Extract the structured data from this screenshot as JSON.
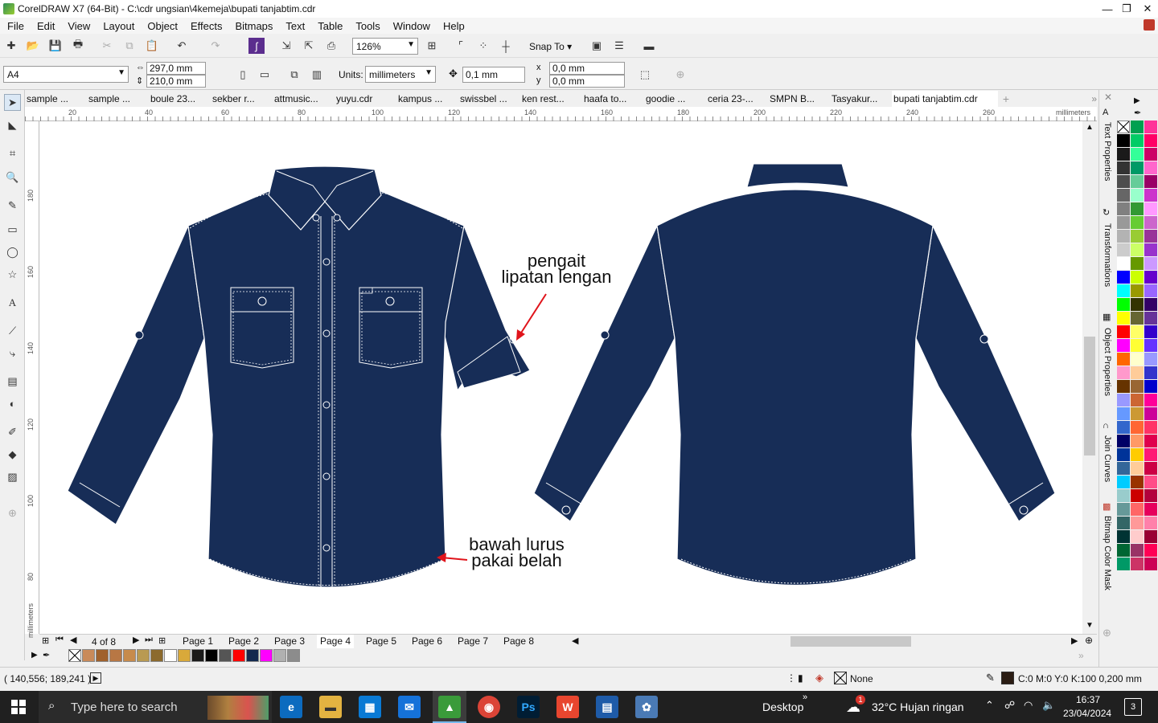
{
  "window": {
    "title": "CorelDRAW X7 (64-Bit) - C:\\cdr ungsian\\4kemeja\\bupati tanjabtim.cdr",
    "minimize": "—",
    "restore": "❐",
    "close": "✕"
  },
  "menu": [
    "File",
    "Edit",
    "View",
    "Layout",
    "Object",
    "Effects",
    "Bitmaps",
    "Text",
    "Table",
    "Tools",
    "Window",
    "Help"
  ],
  "toolbar": {
    "zoom": "126%",
    "snap_to": "Snap To"
  },
  "property_bar": {
    "page_size": "A4",
    "width": "297,0 mm",
    "height": "210,0 mm",
    "units_label": "Units:",
    "units": "millimeters",
    "nudge": "0,1 mm",
    "dup_x": "0,0 mm",
    "dup_y": "0,0 mm"
  },
  "doc_tabs": [
    "sample ...",
    "sample ...",
    "boule 23...",
    "sekber r...",
    "attmusic...",
    "yuyu.cdr",
    "kampus ...",
    "swissbel ...",
    "ken rest...",
    "haafa to...",
    "goodie ...",
    "ceria 23-...",
    "SMPN B...",
    "Tasyakur...",
    "bupati tanjabtim.cdr"
  ],
  "ruler": {
    "h_ticks": [
      "20",
      "40",
      "60",
      "80",
      "100",
      "120",
      "140",
      "160",
      "180",
      "200",
      "220",
      "240",
      "260"
    ],
    "h_unit": "millimeters",
    "v_ticks": [
      "180",
      "160",
      "140",
      "120",
      "100",
      "80"
    ],
    "v_unit": "millimeters"
  },
  "annotations": {
    "a1_line1": "pengait",
    "a1_line2": "lipatan lengan",
    "a2_line1": "bawah lurus",
    "a2_line2": "pakai belah"
  },
  "pages": {
    "counter": "4 of 8",
    "tabs": [
      "Page 1",
      "Page 2",
      "Page 3",
      "Page 4",
      "Page 5",
      "Page 6",
      "Page 7",
      "Page 8"
    ],
    "active": "Page 4"
  },
  "status": {
    "coords": "( 140,556; 189,241 )",
    "fill": "None",
    "outline": "C:0 M:0 Y:0 K:100  0,200 mm"
  },
  "dockers": [
    "Text Properties",
    "Transformations",
    "Object Properties",
    "Join Curves",
    "Bitmap Color Mask"
  ],
  "colors": {
    "shirt": "#172d57",
    "arrow": "#e0141b",
    "accent": "#3a9b3a"
  },
  "bottom_swatches": [
    "#c98a5a",
    "#a0612c",
    "#b87744",
    "#c78b4c",
    "#b99a52",
    "#8c6a2d",
    "#ffffff",
    "#d9a93a",
    "#1a1a1a",
    "#000000",
    "#555555",
    "#ff0000",
    "#13294f",
    "#ff00ff",
    "#b0b0b0",
    "#8c8c8c"
  ],
  "palette_col1": [
    "#ffffff",
    "#000000",
    "#1a1a1a",
    "#333333",
    "#4d4d4d",
    "#666666",
    "#808080",
    "#999999",
    "#b3b3b3",
    "#cccccc",
    "#ffffff",
    "#0000ff",
    "#00ffff",
    "#00ff00",
    "#ffff00",
    "#ff0000",
    "#ff00ff",
    "#ff6600",
    "#ff99cc",
    "#663300",
    "#9999ff",
    "#6699ff",
    "#3366cc",
    "#000066",
    "#003399",
    "#336699",
    "#00ccff",
    "#99cccc",
    "#669999",
    "#336666",
    "#003333",
    "#006633",
    "#009966"
  ],
  "palette_col2": [
    "#00a050",
    "#00cc66",
    "#33ff99",
    "#009966",
    "#66cc99",
    "#99ffcc",
    "#339933",
    "#66cc33",
    "#99cc33",
    "#ccff66",
    "#669900",
    "#ccff00",
    "#999900",
    "#333300",
    "#666633",
    "#ffff66",
    "#ffff33",
    "#ffffcc",
    "#ffcc99",
    "#996633",
    "#cc6633",
    "#cc9933",
    "#ff6633",
    "#ff9966",
    "#ffcc00",
    "#ffcc99",
    "#993300",
    "#cc0000",
    "#ff6666",
    "#ff9999",
    "#ffcccc",
    "#993366",
    "#cc3366"
  ],
  "palette_col3": [
    "#ff3399",
    "#ff0066",
    "#cc0066",
    "#ff66cc",
    "#990066",
    "#cc33cc",
    "#ff99ff",
    "#cc66cc",
    "#993399",
    "#9933cc",
    "#cc99ff",
    "#6600cc",
    "#9966ff",
    "#330066",
    "#663399",
    "#3300cc",
    "#6633ff",
    "#9999ff",
    "#3333cc",
    "#0000cc",
    "#ff0099",
    "#cc0099",
    "#ff3366",
    "#e0004d",
    "#ff1a75",
    "#cc0044",
    "#ff4d88",
    "#b3003c",
    "#e6005c",
    "#ff80aa",
    "#990033",
    "#ff0055",
    "#cc0055"
  ],
  "taskbar": {
    "search_placeholder": "Type here to search",
    "desktop": "Desktop",
    "weather": "32°C  Hujan ringan",
    "time": "16:37",
    "date": "23/04/2024",
    "notif_count": "3",
    "weather_badge": "1"
  }
}
